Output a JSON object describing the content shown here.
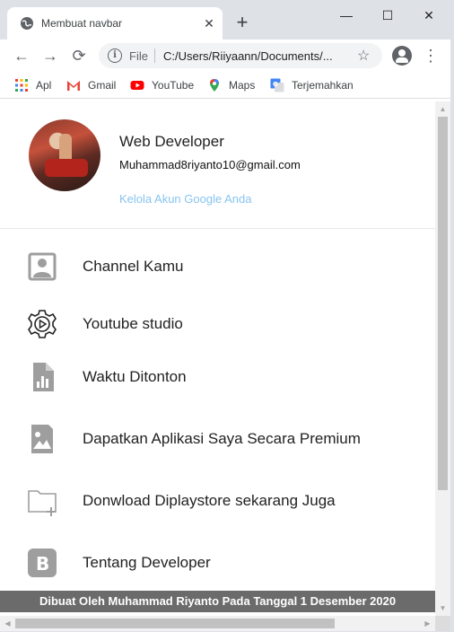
{
  "browser": {
    "tab_title": "Membuat navbar",
    "tab_close": "✕",
    "new_tab": "+",
    "window_controls": {
      "minimize": "—",
      "maximize": "☐",
      "close": "✕"
    },
    "nav": {
      "back": "←",
      "forward": "→",
      "reload": "⟳"
    },
    "address": {
      "scheme": "File",
      "url": "C:/Users/Riiyaann/Documents/...",
      "info": "i"
    },
    "bookmark_star": "☆",
    "menu": "⋮"
  },
  "bookmarks": [
    {
      "label": "Apl",
      "icon": "apps-grid-icon"
    },
    {
      "label": "Gmail",
      "icon": "gmail-icon"
    },
    {
      "label": "YouTube",
      "icon": "youtube-icon"
    },
    {
      "label": "Maps",
      "icon": "maps-icon"
    },
    {
      "label": "Terjemahkan",
      "icon": "translate-icon"
    }
  ],
  "profile": {
    "name": "Web Developer",
    "email": "Muhammad8riyanto10@gmail.com",
    "manage_link": "Kelola Akun Google Anda",
    "link_color": "#88c4f0"
  },
  "menu_items": [
    {
      "label": "Channel Kamu",
      "icon": "account-box-icon"
    },
    {
      "label": "Youtube studio",
      "icon": "settings-play-icon"
    },
    {
      "label": "Waktu Ditonton",
      "icon": "stats-document-icon"
    },
    {
      "label": "Dapatkan Aplikasi Saya Secara Premium",
      "icon": "image-icon"
    },
    {
      "label": "Donwload Diplaystore sekarang Juga",
      "icon": "folder-add-icon"
    },
    {
      "label": "Tentang Developer",
      "icon": "letter-b-icon"
    }
  ],
  "footer": {
    "text": "Dibuat Oleh Muhammad Riyanto Pada Tanggal 1 Desember 2020"
  },
  "scrollbars": {
    "up": "▲",
    "down": "▼",
    "left": "◀",
    "right": "▶"
  },
  "colors": {
    "icon_gray": "#9e9e9e",
    "footer_bg": "#6b6b6b",
    "tabstrip": "#dee1e6"
  }
}
